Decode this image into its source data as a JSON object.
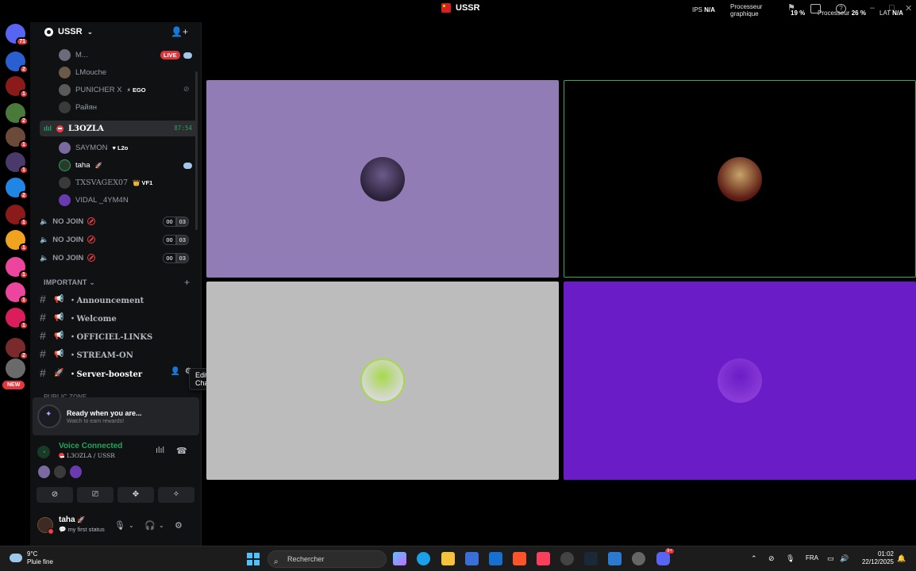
{
  "window": {
    "title": "USSR",
    "stats": {
      "ips_label": "IPS",
      "ips_value": "N/A",
      "gpu_label_1": "Processeur",
      "gpu_label_2": "graphique",
      "gpu_value": "19 %",
      "cpu_label": "Processeur",
      "cpu_value": "26 %",
      "lat_label": "LAT",
      "lat_value": "N/A"
    }
  },
  "rail": {
    "servers": [
      {
        "badge": "71",
        "color": "#5865f2",
        "icon": "discord-home-icon"
      },
      {
        "badge": "2",
        "color": "#2a5fd1",
        "icon": "server-icon"
      },
      {
        "badge": "1",
        "color": "#8b1a1a",
        "icon": "server-icon"
      },
      {
        "badge": "2",
        "color": "#4a7a3a",
        "icon": "server-icon"
      },
      {
        "badge": "1",
        "color": "#6b4a3a",
        "icon": "server-icon"
      },
      {
        "badge": "1",
        "color": "#4a3a6b",
        "icon": "server-icon"
      },
      {
        "badge": "2",
        "color": "#1f86e6",
        "icon": "server-icon"
      },
      {
        "badge": "1",
        "color": "#8b1a1a",
        "icon": "server-icon"
      },
      {
        "badge": "1",
        "color": "#f0a31e",
        "icon": "server-icon"
      },
      {
        "badge": "1",
        "color": "#eb459e",
        "icon": "server-icon"
      },
      {
        "badge": "1",
        "color": "#eb459e",
        "icon": "server-icon"
      },
      {
        "badge": "1",
        "color": "#d91e5b",
        "icon": "server-icon"
      },
      {
        "badge": "2",
        "color": "#7a2a2a",
        "icon": "server-icon"
      },
      {
        "badge": "",
        "color": "#6a6a6a",
        "icon": "server-icon"
      }
    ],
    "new_label": "NEW"
  },
  "sidebar": {
    "server_name": "USSR",
    "voice_members_top": [
      {
        "name": "M...",
        "live": "LIVE",
        "color": "#6b6b7a"
      },
      {
        "name": "LMouche",
        "color": "#6b5a4a"
      },
      {
        "name": "PUNICHER X",
        "tag": "⚡ EGO",
        "color": "#5a5a5a"
      },
      {
        "name": "Райян",
        "color": "#3a3a3a"
      }
    ],
    "active_channel": {
      "name": "L3OZLA",
      "timer": "87:54"
    },
    "active_members": [
      {
        "name": "SAYMON",
        "tag": "♥ L2o",
        "color": "#7a6aa0"
      },
      {
        "name": "taha",
        "tag": "🚀",
        "color": "#2a3a2a"
      },
      {
        "name": "TXSVAGEX07",
        "tag": "👑 VF1",
        "color": "#3a3a3a"
      },
      {
        "name": "VIDAL _4YM4N",
        "color": "#6a3ab0"
      }
    ],
    "no_join_channels": [
      {
        "name": "NO JOIN",
        "a": "00",
        "b": "03"
      },
      {
        "name": "NO JOIN",
        "a": "00",
        "b": "03"
      },
      {
        "name": "NO JOIN",
        "a": "00",
        "b": "03"
      }
    ],
    "category": "IMPORTANT",
    "text_channels": [
      {
        "name": "・Announcement"
      },
      {
        "name": "・Welcome"
      },
      {
        "name": "・OFFICIEL-LINKS"
      },
      {
        "name": "・STREAM-ON"
      },
      {
        "name": "・Server-booster"
      }
    ],
    "tooltip": "Edit Channel",
    "next_category": "PUBLIC ZONE",
    "reward": {
      "title": "Ready when you are...",
      "subtitle": "Watch to earn rewards!"
    },
    "voice": {
      "title": "Voice Connected",
      "channel": "L3OZLA / USSR"
    },
    "user": {
      "name": "taha",
      "tag": "🚀",
      "status": "my first status"
    }
  },
  "tiles": [
    {
      "bg": "#927cb5",
      "avatar": "#2b2138",
      "ring": "#6a5a8a"
    },
    {
      "bg": "#000000",
      "avatar": "#5a1a12",
      "ring": "#c9a46a",
      "border": "#3ba55d"
    },
    {
      "bg": "#bcbcbc",
      "avatar": "#d8d8d8",
      "ring": "#a6d94a"
    },
    {
      "bg": "#6a1dc7",
      "avatar": "#8a3ad6",
      "ring": "#6a1dc7"
    }
  ],
  "taskbar": {
    "weather_temp": "9°C",
    "weather_desc": "Pluie fine",
    "search_placeholder": "Rechercher",
    "lang": "FRA",
    "time": "01:02",
    "date": "22/12/2025",
    "discord_badge": "9+"
  }
}
